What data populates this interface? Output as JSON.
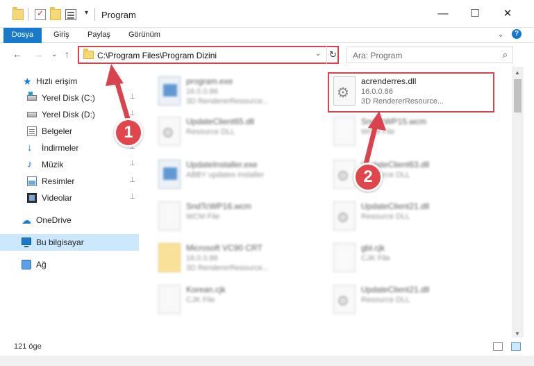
{
  "window": {
    "title": "Program",
    "minimize": "—",
    "maximize": "☐",
    "close": "✕",
    "qa_dropdown": "▾"
  },
  "ribbon": {
    "tabs": [
      "Dosya",
      "Giriş",
      "Paylaş",
      "Görünüm"
    ],
    "collapse": "⌄",
    "help": "?"
  },
  "nav": {
    "back": "←",
    "forward": "→",
    "recent": "⌄",
    "up": "↑",
    "address": "C:\\Program Files\\Program Dizini",
    "address_chevron": "⌄",
    "refresh": "↻",
    "search_placeholder": "Ara: Program",
    "search_icon": "⌕"
  },
  "sidebar": {
    "items": [
      {
        "label": "Hızlı erişim",
        "icon": "star-icon"
      },
      {
        "label": "Yerel Disk (C:)",
        "icon": "drive-icon",
        "pinned": true
      },
      {
        "label": "Yerel Disk (D:)",
        "icon": "drive-icon",
        "pinned": true
      },
      {
        "label": "Belgeler",
        "icon": "document-icon",
        "pinned": true
      },
      {
        "label": "İndirmeler",
        "icon": "download-icon",
        "pinned": true
      },
      {
        "label": "Müzik",
        "icon": "music-icon",
        "pinned": true
      },
      {
        "label": "Resimler",
        "icon": "pictures-icon",
        "pinned": true
      },
      {
        "label": "Videolar",
        "icon": "video-icon",
        "pinned": true
      },
      {
        "label": "OneDrive",
        "icon": "cloud-icon"
      },
      {
        "label": "Bu bilgisayar",
        "icon": "computer-icon",
        "selected": true
      },
      {
        "label": "Ağ",
        "icon": "network-icon"
      }
    ],
    "pin_glyph": "📌"
  },
  "files": {
    "left": [
      {
        "name": "program.exe",
        "l2": "16.0.0.86",
        "l3": "3D RendererResource...",
        "icon": "exe"
      },
      {
        "name": "UpdateClient65.dll",
        "l2": "Resource DLL",
        "l3": "",
        "icon": "gear"
      },
      {
        "name": "UpdateInstaller.exe",
        "l2": "ABBY updates installer",
        "l3": "",
        "icon": "exe"
      },
      {
        "name": "SndTcWP16.wcm",
        "l2": "WCM File",
        "l3": "",
        "icon": "doc"
      },
      {
        "name": "Microsoft VC90 CRT",
        "l2": "16.0.0.86",
        "l3": "3D RendererResource...",
        "icon": "folder"
      },
      {
        "name": "Korean.cjk",
        "l2": "CJK File",
        "l3": "",
        "icon": "doc"
      }
    ],
    "right": [
      {
        "name": "acrenderres.dll",
        "l2": "16.0.0.86",
        "l3": "3D RendererResource...",
        "icon": "gear",
        "highlight": true
      },
      {
        "name": "SndTcWP15.wcm",
        "l2": "WCM File",
        "l3": "",
        "icon": "doc"
      },
      {
        "name": "UpdateClient63.dll",
        "l2": "Resource DLL",
        "l3": "",
        "icon": "gear"
      },
      {
        "name": "UpdateClient21.dll",
        "l2": "Resource DLL",
        "l3": "",
        "icon": "gear"
      },
      {
        "name": "gbl.cjk",
        "l2": "CJK File",
        "l3": "",
        "icon": "doc"
      },
      {
        "name": "UpdateClient21.dll",
        "l2": "Resource DLL",
        "l3": "",
        "icon": "gear"
      }
    ]
  },
  "callouts": [
    "1",
    "2"
  ],
  "status": {
    "item_count": "121 öge"
  },
  "colors": {
    "accent": "#1979ca",
    "annotation_red": "#d9434e",
    "selection": "#cce8ff"
  }
}
